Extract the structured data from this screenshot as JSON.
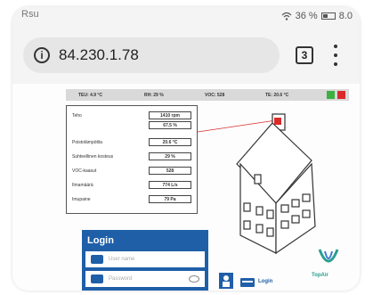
{
  "status_bar": {
    "left_text": "Rsu",
    "signal": "36 %",
    "time": "8.0"
  },
  "browser": {
    "url": "84.230.1.78",
    "tab_count": "3"
  },
  "top_strip": {
    "items": [
      {
        "label": "TEU:",
        "value": "4.9 °C"
      },
      {
        "label": "RH:",
        "value": "29 %"
      },
      {
        "label": "VOC:",
        "value": "528"
      },
      {
        "label": "TE:",
        "value": "20.6 °C"
      }
    ],
    "green_color": "#3cb043",
    "red_color": "#d92b2b"
  },
  "panel": {
    "rows": [
      {
        "label": "Teho",
        "value": "1410 rpm"
      },
      {
        "label": "",
        "value": "67.5 %"
      },
      {
        "label": "Poistolämpötila",
        "value": "20.6 °C"
      },
      {
        "label": "Suhteellinen kosteus",
        "value": "29 %"
      },
      {
        "label": "VOC-kaasut",
        "value": "528"
      },
      {
        "label": "Ilmamäärä",
        "value": "774 L/s"
      },
      {
        "label": "Imupaine",
        "value": "79 Pa"
      }
    ]
  },
  "login": {
    "title": "Login",
    "username_placeholder": "User name",
    "password_placeholder": "Password",
    "link_label": "Login",
    "panel_color": "#1f5fa8"
  },
  "logo": {
    "text": "TopAir"
  }
}
